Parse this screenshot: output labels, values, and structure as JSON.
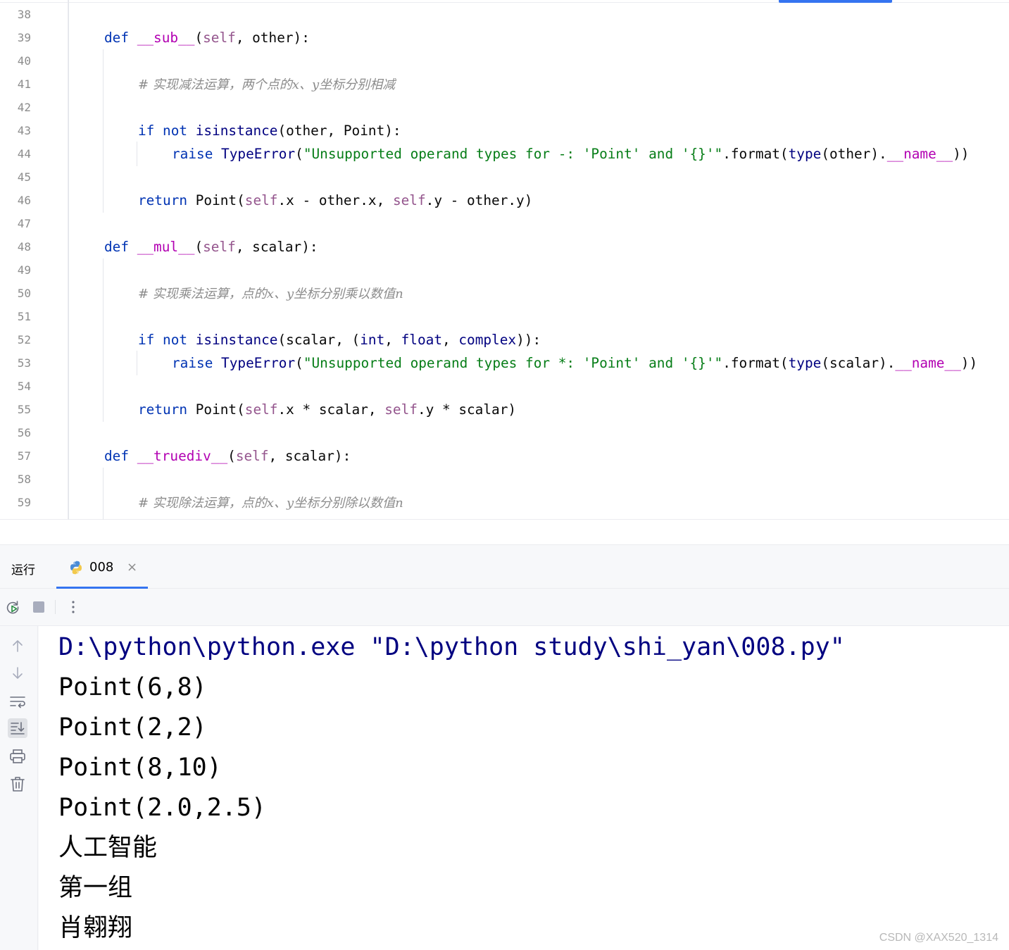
{
  "editor": {
    "line_numbers": [
      "38",
      "39",
      "40",
      "41",
      "42",
      "43",
      "44",
      "45",
      "46",
      "47",
      "48",
      "49",
      "50",
      "51",
      "52",
      "53",
      "54",
      "55",
      "56",
      "57",
      "58",
      "59"
    ],
    "lines": [
      [],
      [
        [
          "kw",
          "def "
        ],
        [
          "dn",
          "__sub__"
        ],
        [
          "",
          "("
        ],
        [
          "sf",
          "self"
        ],
        [
          "",
          ", other):"
        ]
      ],
      [],
      [
        [
          "cm",
          "# 实现减法运算，两个点的x、y坐标分别相减"
        ]
      ],
      [],
      [
        [
          "kw",
          "if not "
        ],
        [
          "bi",
          "isinstance"
        ],
        [
          "",
          "(other, Point):"
        ]
      ],
      [
        [
          "kw",
          "raise "
        ],
        [
          "bi",
          "TypeError"
        ],
        [
          "",
          "("
        ],
        [
          "st",
          "\"Unsupported operand types for -: 'Point' and '{}'\""
        ],
        [
          "",
          ".format("
        ],
        [
          "bi",
          "type"
        ],
        [
          "",
          "(other)."
        ],
        [
          "dn",
          "__name__"
        ],
        [
          "",
          "))"
        ]
      ],
      [],
      [
        [
          "kw",
          "return "
        ],
        [
          "",
          "Point("
        ],
        [
          "sf",
          "self"
        ],
        [
          "",
          ".x - other.x, "
        ],
        [
          "sf",
          "self"
        ],
        [
          "",
          ".y - other.y)"
        ]
      ],
      [],
      [
        [
          "kw",
          "def "
        ],
        [
          "dn",
          "__mul__"
        ],
        [
          "",
          "("
        ],
        [
          "sf",
          "self"
        ],
        [
          "",
          ", scalar):"
        ]
      ],
      [],
      [
        [
          "cm",
          "# 实现乘法运算，点的x、y坐标分别乘以数值n"
        ]
      ],
      [],
      [
        [
          "kw",
          "if not "
        ],
        [
          "bi",
          "isinstance"
        ],
        [
          "",
          "(scalar, ("
        ],
        [
          "bi",
          "int"
        ],
        [
          "",
          ", "
        ],
        [
          "bi",
          "float"
        ],
        [
          "",
          ", "
        ],
        [
          "bi",
          "complex"
        ],
        [
          "",
          "))"
        ],
        [
          "",
          ":"
        ]
      ],
      [
        [
          "kw",
          "raise "
        ],
        [
          "bi",
          "TypeError"
        ],
        [
          "",
          "("
        ],
        [
          "st",
          "\"Unsupported operand types for *: 'Point' and '{}'\""
        ],
        [
          "",
          ".format("
        ],
        [
          "bi",
          "type"
        ],
        [
          "",
          "(scalar)."
        ],
        [
          "dn",
          "__name__"
        ],
        [
          "",
          "))"
        ]
      ],
      [],
      [
        [
          "kw",
          "return "
        ],
        [
          "",
          "Point("
        ],
        [
          "sf",
          "self"
        ],
        [
          "",
          ".x * scalar, "
        ],
        [
          "sf",
          "self"
        ],
        [
          "",
          ".y * scalar)"
        ]
      ],
      [],
      [
        [
          "kw",
          "def "
        ],
        [
          "dn",
          "__truediv__"
        ],
        [
          "",
          "("
        ],
        [
          "sf",
          "self"
        ],
        [
          "",
          ", scalar):"
        ]
      ],
      [],
      [
        [
          "cm",
          "# 实现除法运算，点的x、y坐标分别除以数值n"
        ]
      ]
    ]
  },
  "run_panel": {
    "title": "运行",
    "tab_label": "008",
    "tab_close": "×",
    "toolbar_more": "⋮"
  },
  "console": {
    "lines": [
      "D:\\python\\python.exe \"D:\\python study\\shi_yan\\008.py\"",
      "Point(6,8)",
      "Point(2,2)",
      "Point(8,10)",
      "Point(2.0,2.5)",
      "人工智能",
      "第一组",
      "肖翱翔"
    ]
  },
  "watermark": "CSDN @XAX520_1314",
  "colors": {
    "keyword": "#0033b3",
    "builtin": "#000080",
    "dunder": "#b200b2",
    "self": "#94558d",
    "string": "#067d17",
    "comment": "#8c8c8c",
    "accent": "#3574f0"
  }
}
